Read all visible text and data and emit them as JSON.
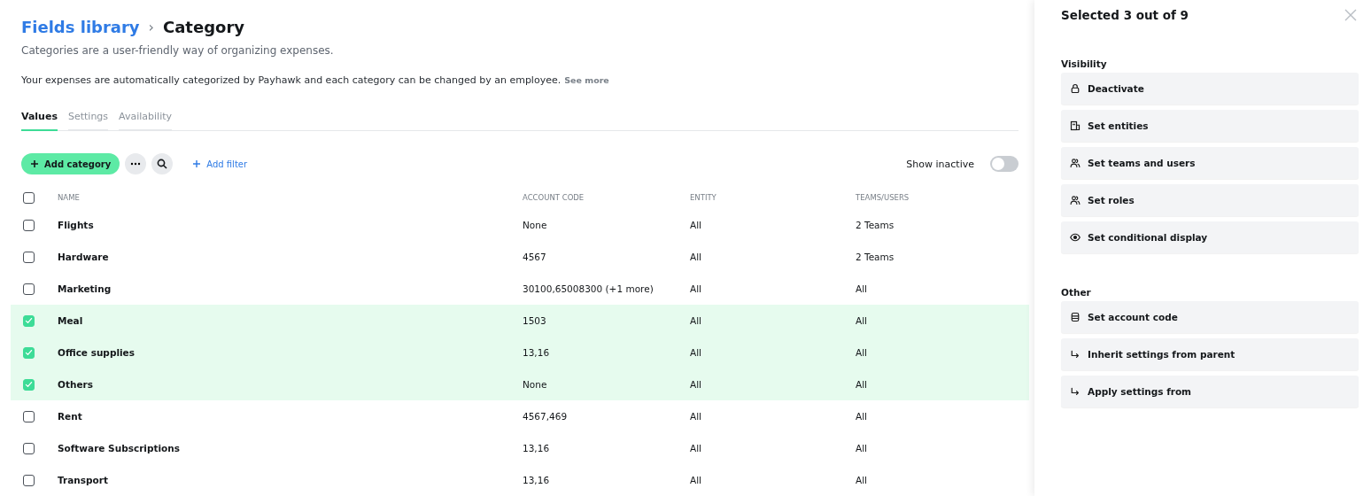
{
  "breadcrumb": {
    "parent": "Fields library",
    "separator": "›",
    "current": "Category"
  },
  "subtitle": "Categories are a user-friendly way of organizing expenses.",
  "description": "Your expenses are automatically categorized by Payhawk and each category can be changed by an employee.",
  "see_more": "See more",
  "tabs": [
    {
      "label": "Values",
      "selected": true
    },
    {
      "label": "Settings",
      "selected": false
    },
    {
      "label": "Availability",
      "selected": false
    }
  ],
  "toolbar": {
    "add_button": "Add category",
    "add_filter": "Add filter",
    "show_inactive": {
      "label": "Show inactive",
      "on": false
    }
  },
  "table": {
    "all_checked": false,
    "columns": [
      "NAME",
      "ACCOUNT CODE",
      "ENTITY",
      "TEAMS/USERS"
    ],
    "rows": [
      {
        "name": "Flights",
        "account_code": "None",
        "entity": "All",
        "teams": "2 Teams",
        "checked": false
      },
      {
        "name": "Hardware",
        "account_code": "4567",
        "entity": "All",
        "teams": "2 Teams",
        "checked": false
      },
      {
        "name": "Marketing",
        "account_code": "30100,65008300 (+1 more)",
        "entity": "All",
        "teams": "All",
        "checked": false
      },
      {
        "name": "Meal",
        "account_code": "1503",
        "entity": "All",
        "teams": "All",
        "checked": true
      },
      {
        "name": "Office supplies",
        "account_code": "13,16",
        "entity": "All",
        "teams": "All",
        "checked": true
      },
      {
        "name": "Others",
        "account_code": "None",
        "entity": "All",
        "teams": "All",
        "checked": true
      },
      {
        "name": "Rent",
        "account_code": "4567,469",
        "entity": "All",
        "teams": "All",
        "checked": false
      },
      {
        "name": "Software Subscriptions",
        "account_code": "13,16",
        "entity": "All",
        "teams": "All",
        "checked": false
      },
      {
        "name": "Transport",
        "account_code": "13,16",
        "entity": "All",
        "teams": "All",
        "checked": false
      }
    ]
  },
  "panel": {
    "title": "Selected 3 out of 9",
    "sections": [
      {
        "title": "Visibility",
        "actions": [
          {
            "label": "Deactivate",
            "kind": "lock"
          },
          {
            "label": "Set entities",
            "kind": "building"
          },
          {
            "label": "Set teams and users",
            "kind": "people"
          },
          {
            "label": "Set roles",
            "kind": "people"
          },
          {
            "label": "Set conditional display",
            "kind": "eye"
          }
        ]
      },
      {
        "title": "Other",
        "actions": [
          {
            "label": "Set account code",
            "kind": "database"
          },
          {
            "label": "Inherit settings from parent",
            "kind": "arrow"
          },
          {
            "label": "Apply settings from",
            "kind": "arrow"
          }
        ]
      }
    ]
  }
}
